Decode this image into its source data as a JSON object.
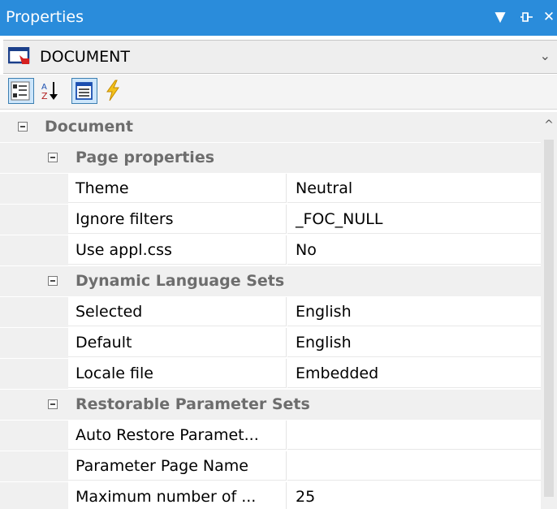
{
  "titlebar": {
    "title": "Properties",
    "buttons": [
      {
        "name": "dropdown-arrow-icon",
        "glyph": "▼"
      },
      {
        "name": "pin-icon",
        "glyph": "⊣"
      },
      {
        "name": "close-icon",
        "glyph": "✕"
      }
    ]
  },
  "object_selector": {
    "value": "DOCUMENT",
    "icon": "document-object-icon",
    "dropdown_glyph": "⌄"
  },
  "toolbar": {
    "buttons": [
      {
        "name": "categorized-view-icon",
        "active": true
      },
      {
        "name": "alphabetical-sort-icon",
        "active": false
      },
      {
        "name": "property-pages-icon",
        "active": true
      },
      {
        "name": "events-lightning-icon",
        "active": false
      }
    ]
  },
  "grid": {
    "root": {
      "label": "Document"
    },
    "categories": [
      {
        "label": "Page properties",
        "properties": [
          {
            "name": "Theme",
            "value": "Neutral"
          },
          {
            "name": "Ignore filters",
            "value": "_FOC_NULL"
          },
          {
            "name": "Use appl.css",
            "value": "No"
          }
        ]
      },
      {
        "label": "Dynamic Language Sets",
        "properties": [
          {
            "name": "Selected",
            "value": "English"
          },
          {
            "name": "Default",
            "value": "English"
          },
          {
            "name": "Locale file",
            "value": "Embedded"
          }
        ]
      },
      {
        "label": "Restorable Parameter Sets",
        "properties": [
          {
            "name": "Auto Restore Paramet...",
            "value": ""
          },
          {
            "name": "Parameter Page Name",
            "value": ""
          },
          {
            "name": "Maximum number of ...",
            "value": "25"
          }
        ]
      }
    ]
  },
  "scrollbar": {
    "up_glyph": "^"
  },
  "colors": {
    "titlebar": "#2a8cdb",
    "category_bg": "#f0f0f0",
    "category_text": "#6d6d6d",
    "active_tool_border": "#3c7fb1"
  }
}
